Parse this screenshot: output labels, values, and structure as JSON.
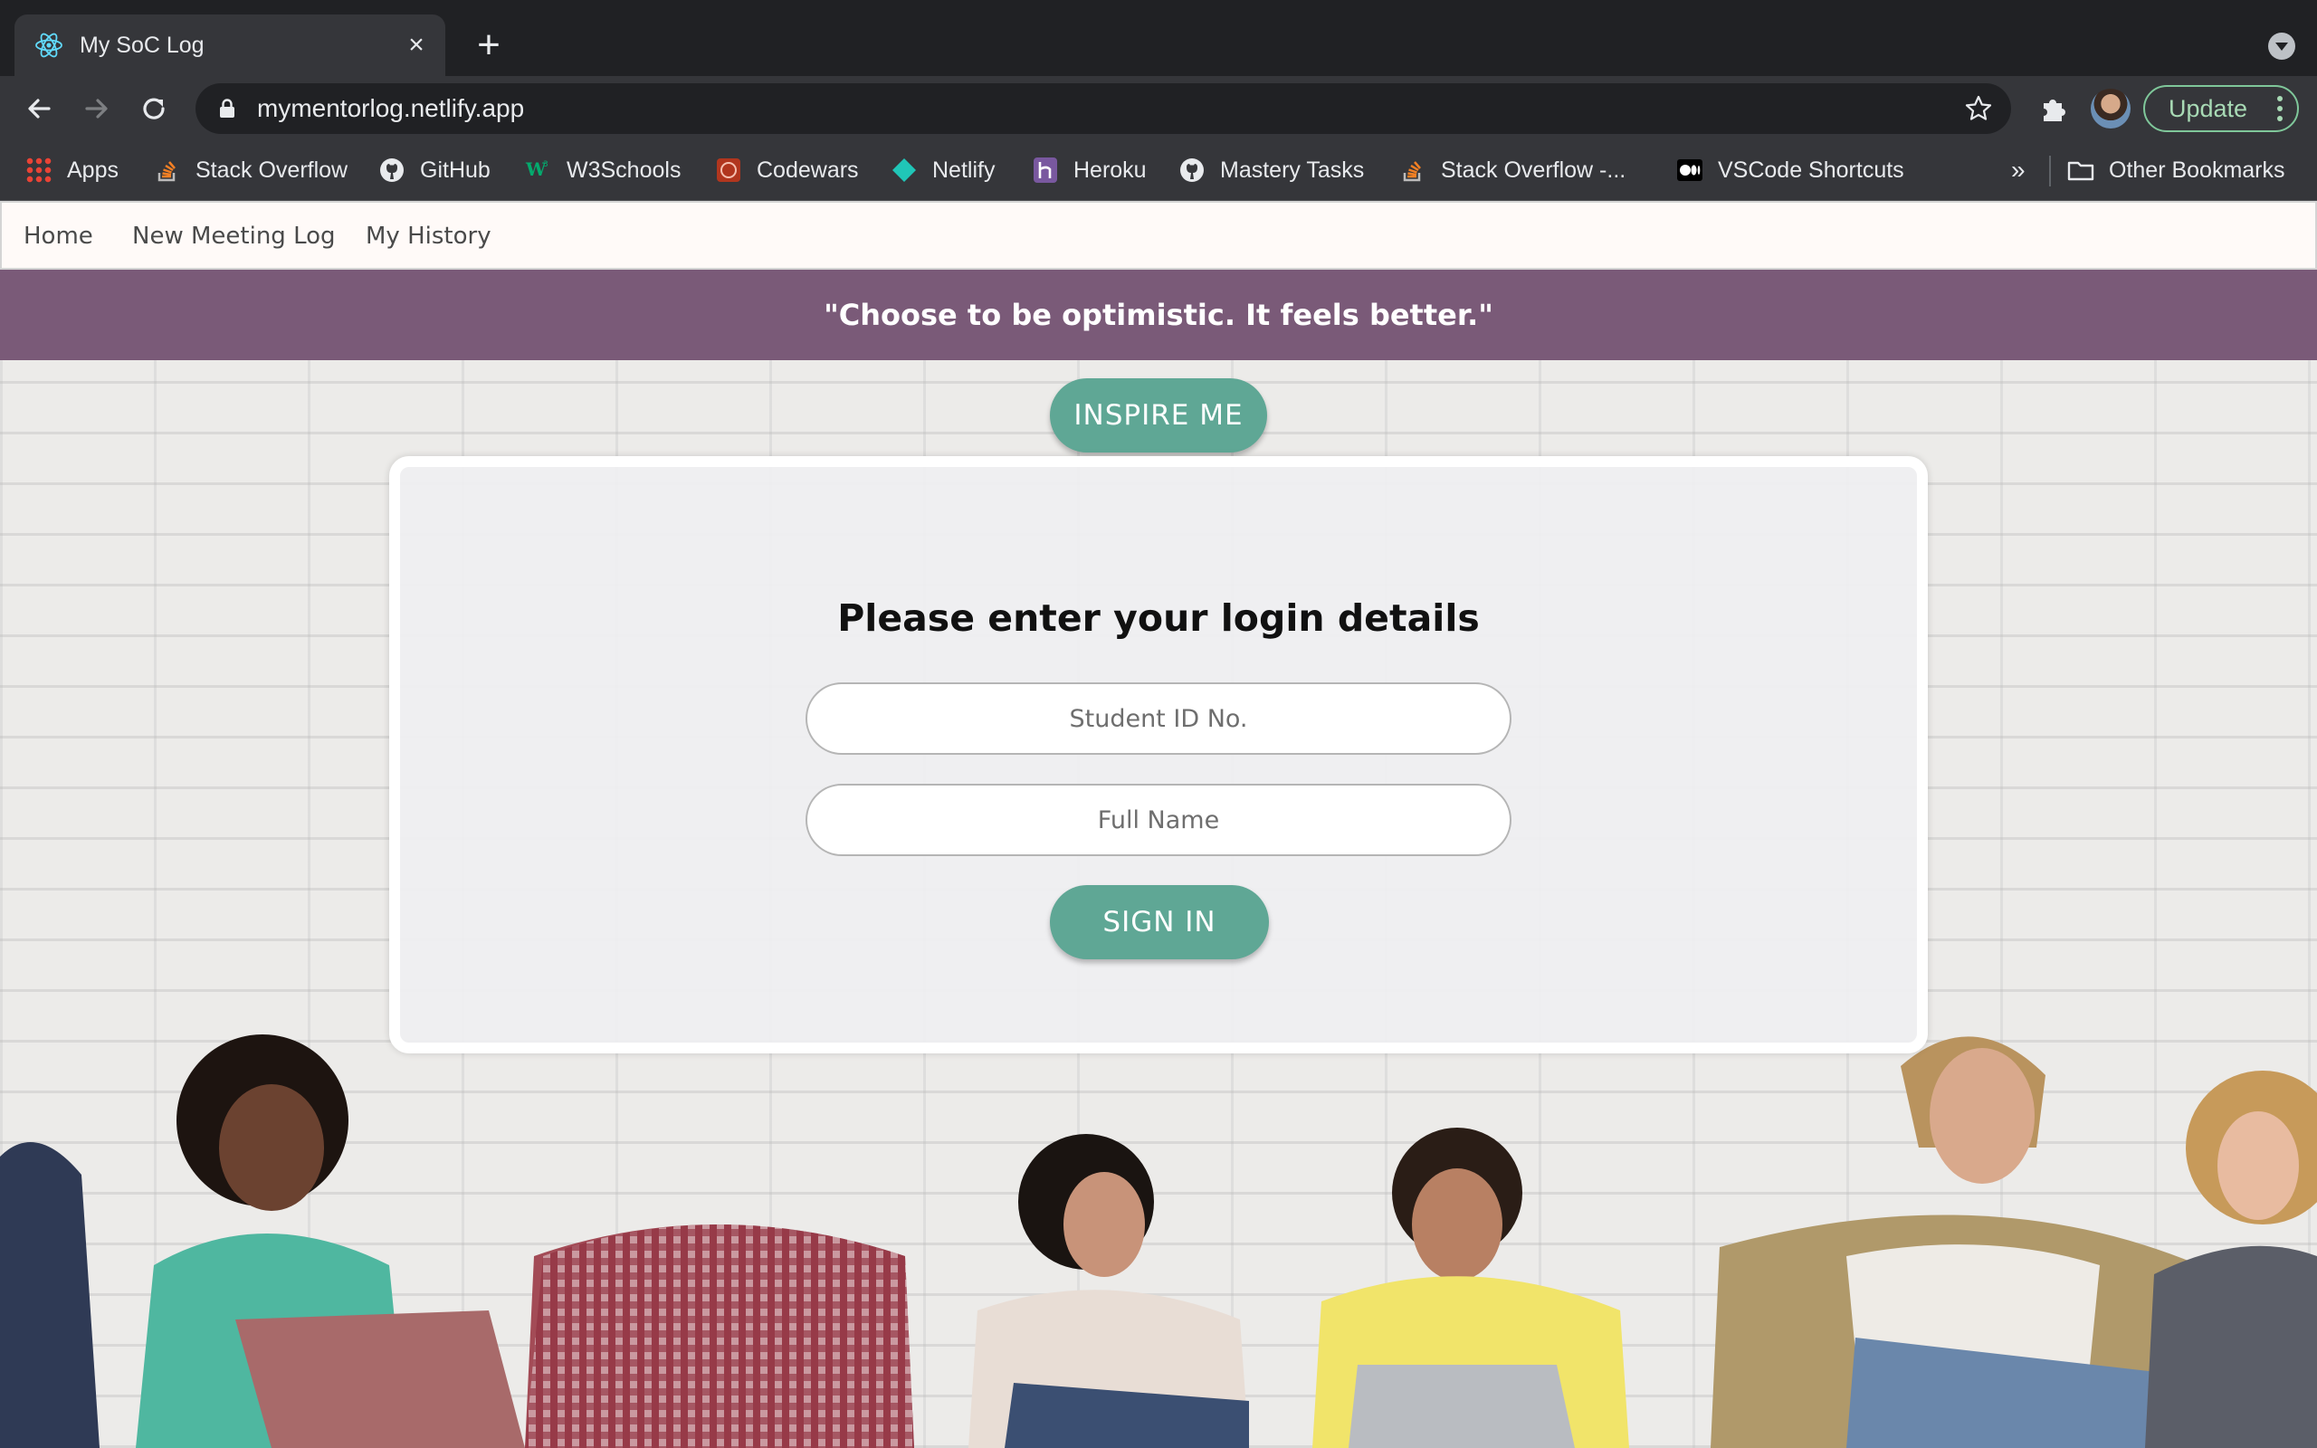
{
  "browser": {
    "tab": {
      "title": "My SoC Log",
      "favicon": "react-icon"
    },
    "url": "mymentorlog.netlify.app",
    "update_label": "Update",
    "bookmarks": [
      {
        "label": "Apps",
        "icon": "apps-grid-icon"
      },
      {
        "label": "Stack Overflow",
        "icon": "stackoverflow-icon"
      },
      {
        "label": "GitHub",
        "icon": "github-icon"
      },
      {
        "label": "W3Schools",
        "icon": "w3schools-icon"
      },
      {
        "label": "Codewars",
        "icon": "codewars-icon"
      },
      {
        "label": "Netlify",
        "icon": "netlify-icon"
      },
      {
        "label": "Heroku",
        "icon": "heroku-icon"
      },
      {
        "label": "Mastery Tasks",
        "icon": "github-icon"
      },
      {
        "label": "Stack Overflow -...",
        "icon": "stackoverflow-icon"
      },
      {
        "label": "VSCode Shortcuts",
        "icon": "medium-icon"
      }
    ],
    "bookmarks_overflow": "»",
    "other_bookmarks": "Other Bookmarks"
  },
  "nav": {
    "items": [
      "Home",
      "New Meeting Log",
      "My History"
    ]
  },
  "quote": "\"Choose to be optimistic. It feels better.\"",
  "inspire_label": "INSPIRE ME",
  "login": {
    "title": "Please enter your login details",
    "student_id_placeholder": "Student ID No.",
    "full_name_placeholder": "Full Name",
    "signin_label": "SIGN IN"
  },
  "colors": {
    "accent": "#5fa795",
    "quote_bar": "#7a5a78",
    "nav_bg": "#fffaf8"
  }
}
